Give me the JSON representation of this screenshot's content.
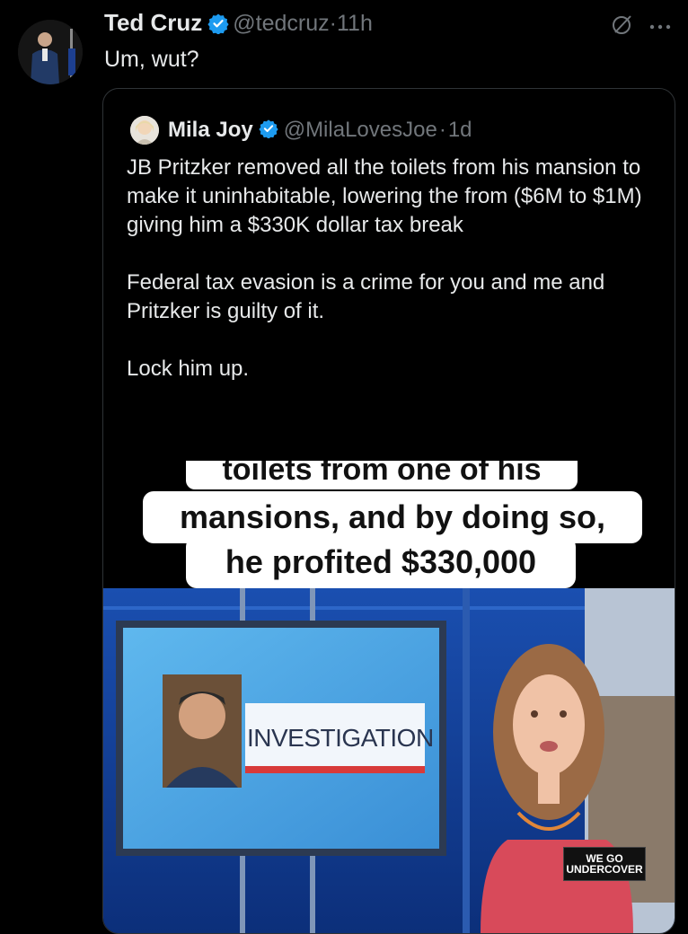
{
  "post": {
    "author_name": "Ted Cruz",
    "author_handle": "@tedcruz",
    "separator": "·",
    "time": "11h",
    "text": "Um, wut?"
  },
  "quoted": {
    "author_name": "Mila Joy",
    "author_handle": "@MilaLovesJoe",
    "separator": "·",
    "time": "1d",
    "paragraphs": [
      "JB Pritzker removed all the toilets from his mansion to make it uninhabitable, lowering the from ($6M to $1M) giving him a $330K dollar tax break",
      "Federal tax evasion is a crime for you and me and Pritzker is guilty of it.",
      "Lock him up."
    ]
  },
  "media": {
    "caption_lines": [
      "toilets from one of his",
      "mansions, and by doing so,",
      "he profited $330,000"
    ],
    "screen_label": "INVESTIGATION",
    "logo_lines": [
      "WE GO",
      "UNDERCOVER"
    ]
  },
  "icons": {
    "grok": "grok-icon",
    "more": "more-icon",
    "verified": "verified-badge-icon"
  },
  "colors": {
    "background": "#000000",
    "text": "#e7e9ea",
    "secondary": "#71767b",
    "verified": "#1d9bf0",
    "border": "#2f3336"
  }
}
